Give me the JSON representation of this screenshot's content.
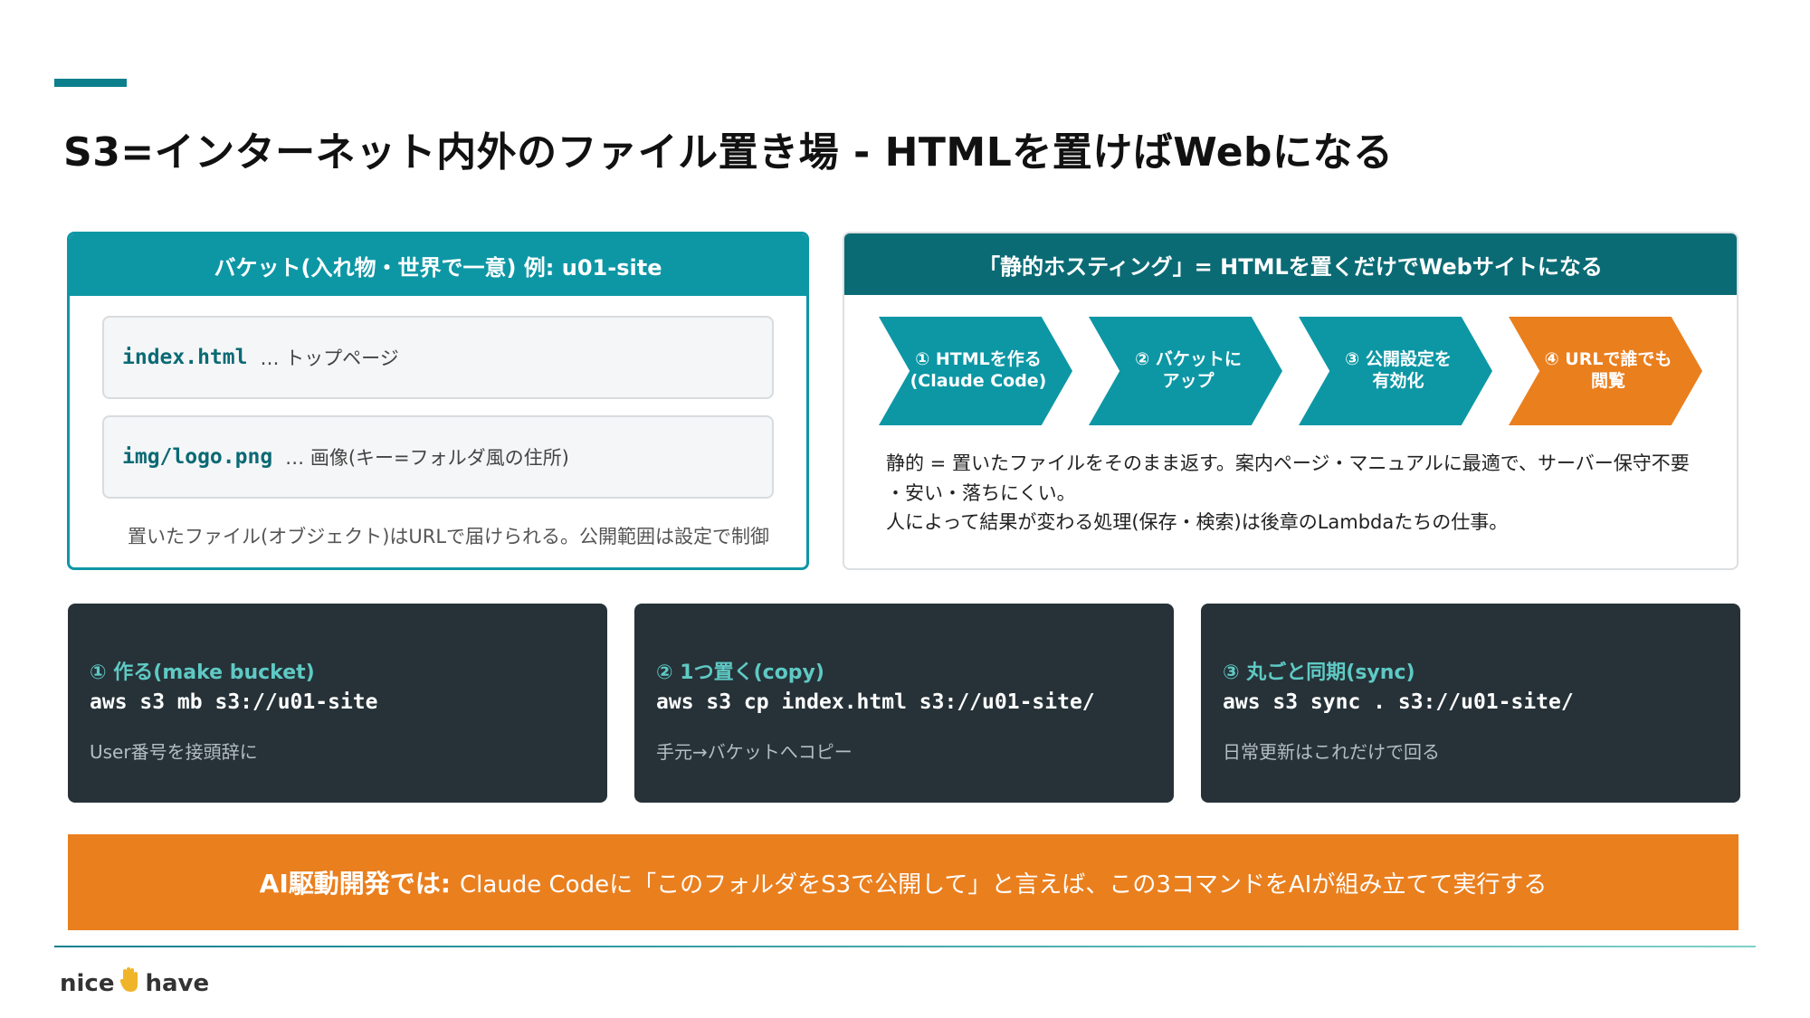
{
  "colors": {
    "teal": "#0d97a5",
    "dark_teal": "#0b6b75",
    "orange": "#ea7f1e",
    "dark_panel": "#263238",
    "cmd_title": "#5fc9c4"
  },
  "title": "S3=インターネット内外のファイル置き場 - HTMLを置けばWebになる",
  "bucket": {
    "header": "バケット(入れ物・世界で一意) 例: u01-site",
    "files": [
      {
        "name": "index.html",
        "desc": "… トップページ"
      },
      {
        "name": "img/logo.png",
        "desc": "… 画像(キー=フォルダ風の住所)"
      }
    ],
    "note": "置いたファイル(オブジェクト)はURLで届けられる。公開範囲は設定で制御"
  },
  "hosting": {
    "header": "「静的ホスティング」= HTMLを置くだけでWebサイトになる",
    "steps": [
      {
        "label": "① HTMLを作る\n(Claude Code)"
      },
      {
        "label": "② バケットに\nアップ"
      },
      {
        "label": "③ 公開設定を\n有効化"
      },
      {
        "label": "④ URLで誰でも\n閲覧"
      }
    ],
    "desc_lines": [
      "静的 = 置いたファイルをそのまま返す。案内ページ・マニュアルに最適で、サーバー保守不要",
      "・安い・落ちにくい。",
      "人によって結果が変わる処理(保存・検索)は後章のLambdaたちの仕事。"
    ]
  },
  "commands": [
    {
      "title": "① 作る(make bucket)",
      "code": "aws s3 mb s3://u01-site",
      "note": "User番号を接頭辞に"
    },
    {
      "title": "② 1つ置く(copy)",
      "code": "aws s3 cp index.html s3://u01-site/",
      "note": "手元→バケットへコピー"
    },
    {
      "title": "③ 丸ごと同期(sync)",
      "code": "aws s3 sync . s3://u01-site/",
      "note": "日常更新はこれだけで回る"
    }
  ],
  "banner": {
    "label": "AI駆動開発では:",
    "text": "Claude Codeに「このフォルダをS3で公開して」と言えば、この3コマンドをAIが組み立てて実行する"
  },
  "footer": {
    "logo_left": "nice",
    "logo_icon": "hand-icon",
    "logo_right": "have"
  }
}
